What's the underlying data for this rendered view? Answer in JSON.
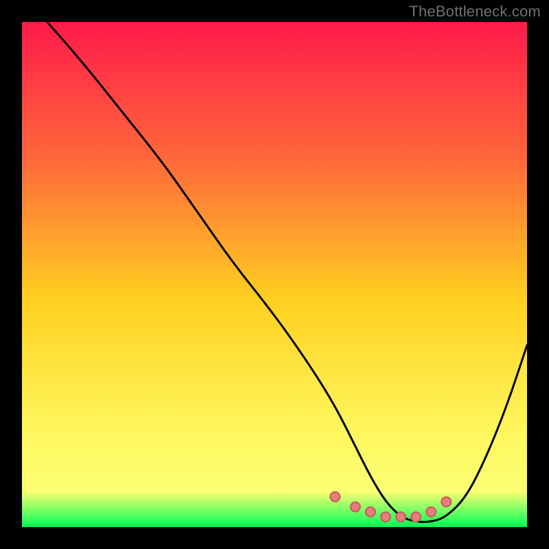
{
  "attribution": "TheBottleneck.com",
  "gradient": {
    "top_color": "#ff1a4a",
    "mid_upper_color": "#ff6b3a",
    "mid_color": "#ffd020",
    "mid_lower_color": "#fff860",
    "bottom_yellow": "#fbff72",
    "bottom_green": "#00ff55"
  },
  "curve": {
    "stroke": "#000000",
    "dot_fill": "#e67c7c",
    "dot_stroke": "#c95a5a"
  },
  "chart_data": {
    "type": "line",
    "title": "",
    "xlabel": "",
    "ylabel": "",
    "xlim": [
      0,
      100
    ],
    "ylim": [
      0,
      100
    ],
    "series": [
      {
        "name": "bottleneck_curve",
        "x": [
          5,
          12,
          20,
          28,
          35,
          42,
          50,
          57,
          62,
          66,
          69,
          72,
          75,
          78,
          81,
          84,
          88,
          92,
          96,
          100
        ],
        "values": [
          100,
          92,
          82,
          72,
          62,
          52,
          42,
          32,
          24,
          16,
          10,
          5,
          2,
          1,
          1,
          2,
          6,
          14,
          24,
          36
        ]
      }
    ],
    "markers": {
      "name": "highlighted_dots",
      "x": [
        62,
        66,
        69,
        72,
        75,
        78,
        81,
        84
      ],
      "values": [
        6,
        4,
        3,
        2,
        2,
        2,
        3,
        5
      ]
    }
  }
}
